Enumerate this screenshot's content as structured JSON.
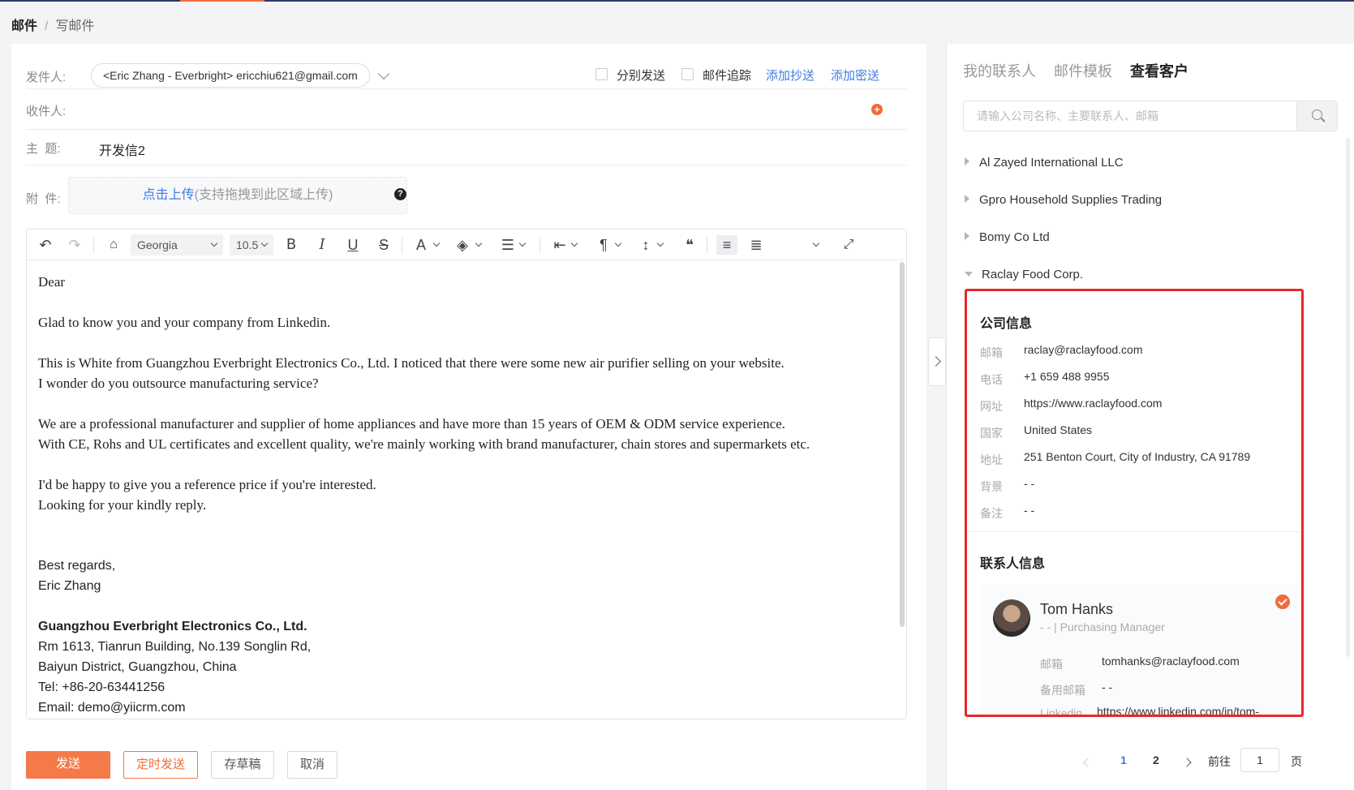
{
  "breadcrumb": {
    "root": "邮件",
    "separator": "/",
    "current": "写邮件"
  },
  "compose": {
    "from_label": "发件人:",
    "from_value": "<Eric Zhang - Everbright> ericchiu621@gmail.com",
    "send_separately": "分别发送",
    "mail_tracking": "邮件追踪",
    "add_cc": "添加抄送",
    "add_bcc": "添加密送",
    "to_label": "收件人:",
    "subject_label": "主  题:",
    "subject_value": "开发信2",
    "attach_label": "附  件:",
    "upload_link": "点击上传",
    "upload_hint": "(支持拖拽到此区域上传)",
    "help_glyph": "?"
  },
  "toolbar": {
    "font_family": "Georgia",
    "font_size": "10.5",
    "bold": "B",
    "italic": "I",
    "underline": "U",
    "strike": "S",
    "font_color": "A"
  },
  "body": [
    "Dear",
    "",
    "Glad to know you and your company from Linkedin.",
    "",
    "This is White from Guangzhou Everbright Electronics Co., Ltd. I noticed that there were some new air purifier selling on your website.",
    "I wonder do you outsource manufacturing service?",
    "",
    "We are a professional manufacturer and supplier of  home appliances and have more than 15 years of OEM & ODM service experience.",
    "With CE, Rohs and UL certificates and excellent quality, we're mainly working with brand manufacturer, chain stores and supermarkets etc.",
    "",
    "I'd be happy to give you a reference price if you're interested.",
    "Looking for your kindly reply."
  ],
  "signature": {
    "regards": "Best regards,",
    "name": "Eric Zhang",
    "company": "Guangzhou Everbright Electronics Co., Ltd.",
    "address1": "Rm 1613, Tianrun Building, No.139 Songlin Rd,",
    "address2": "Baiyun District, Guangzhou, China",
    "tel": "Tel: +86-20-63441256",
    "email": "Email: demo@yiicrm.com"
  },
  "actions": {
    "send": "发送",
    "scheduled": "定时发送",
    "draft": "存草稿",
    "cancel": "取消"
  },
  "sidebar": {
    "tabs": [
      "我的联系人",
      "邮件模板",
      "查看客户"
    ],
    "active_tab": "查看客户",
    "search_placeholder": "请输入公司名称、主要联系人、邮箱",
    "companies": [
      "Al Zayed International LLC",
      "Gpro Household Supplies Trading",
      "Bomy Co Ltd",
      "Raclay Food Corp."
    ],
    "company_info": {
      "title": "公司信息",
      "fields": [
        {
          "k": "邮箱",
          "v": "raclay@raclayfood.com"
        },
        {
          "k": "电话",
          "v": "+1 659 488 9955"
        },
        {
          "k": "网址",
          "v": "https://www.raclayfood.com"
        },
        {
          "k": "国家",
          "v": "United States"
        },
        {
          "k": "地址",
          "v": "251 Benton Court, City of Industry, CA 91789"
        },
        {
          "k": "背景",
          "v": "- -"
        },
        {
          "k": "备注",
          "v": "- -"
        }
      ]
    },
    "contact_info": {
      "title": "联系人信息",
      "name": "Tom Hanks",
      "role": "- - | Purchasing Manager",
      "fields": [
        {
          "k": "邮箱",
          "v": "tomhanks@raclayfood.com"
        },
        {
          "k": "备用邮箱",
          "v": "- -"
        },
        {
          "k": "Linkedin",
          "v": "https://www.linkedin.com/in/tom-"
        }
      ]
    },
    "pagination": {
      "pages": [
        "1",
        "2"
      ],
      "current": "1",
      "goto_label": "前往",
      "goto_value": "1",
      "page_suffix": "页"
    }
  },
  "colors": {
    "accent": "#f26b3a",
    "link": "#3f7be0",
    "highlight_border": "#e8272a"
  }
}
